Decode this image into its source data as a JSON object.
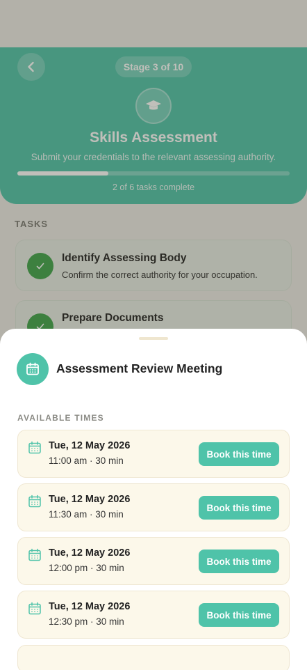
{
  "header": {
    "stage_label": "Stage 3 of 10",
    "title": "Skills Assessment",
    "subtitle": "Submit your credentials to the relevant assessing authority.",
    "progress_fraction": 0.333,
    "progress_text": "2 of 6 tasks complete"
  },
  "tasks": {
    "section_label": "TASKS",
    "items": [
      {
        "title": "Identify Assessing Body",
        "description": "Confirm the correct authority for your occupation.",
        "completed": true
      },
      {
        "title": "Prepare Documents",
        "description": "",
        "completed": true
      }
    ]
  },
  "sheet": {
    "title": "Assessment Review Meeting",
    "section_label": "AVAILABLE TIMES",
    "slots": [
      {
        "date": "Tue, 12 May 2026",
        "time": "11:00 am",
        "duration": "30 min",
        "button": "Book this time"
      },
      {
        "date": "Tue, 12 May 2026",
        "time": "11:30 am",
        "duration": "30 min",
        "button": "Book this time"
      },
      {
        "date": "Tue, 12 May 2026",
        "time": "12:00 pm",
        "duration": "30 min",
        "button": "Book this time"
      },
      {
        "date": "Tue, 12 May 2026",
        "time": "12:30 pm",
        "duration": "30 min",
        "button": "Book this time"
      }
    ]
  },
  "slot_text": [
    "11:00 am  ·  30 min",
    "11:30 am  ·  30 min",
    "12:00 pm  ·  30 min",
    "12:30 pm  ·  30 min"
  ],
  "colors": {
    "accent": "#4fc3a9",
    "check": "#3fa24a",
    "slot_bg": "#fcf8ea"
  },
  "icons": {
    "back": "chevron-left-icon",
    "stage": "graduation-cap-icon",
    "meeting": "calendar-icon",
    "task": "check-icon"
  }
}
